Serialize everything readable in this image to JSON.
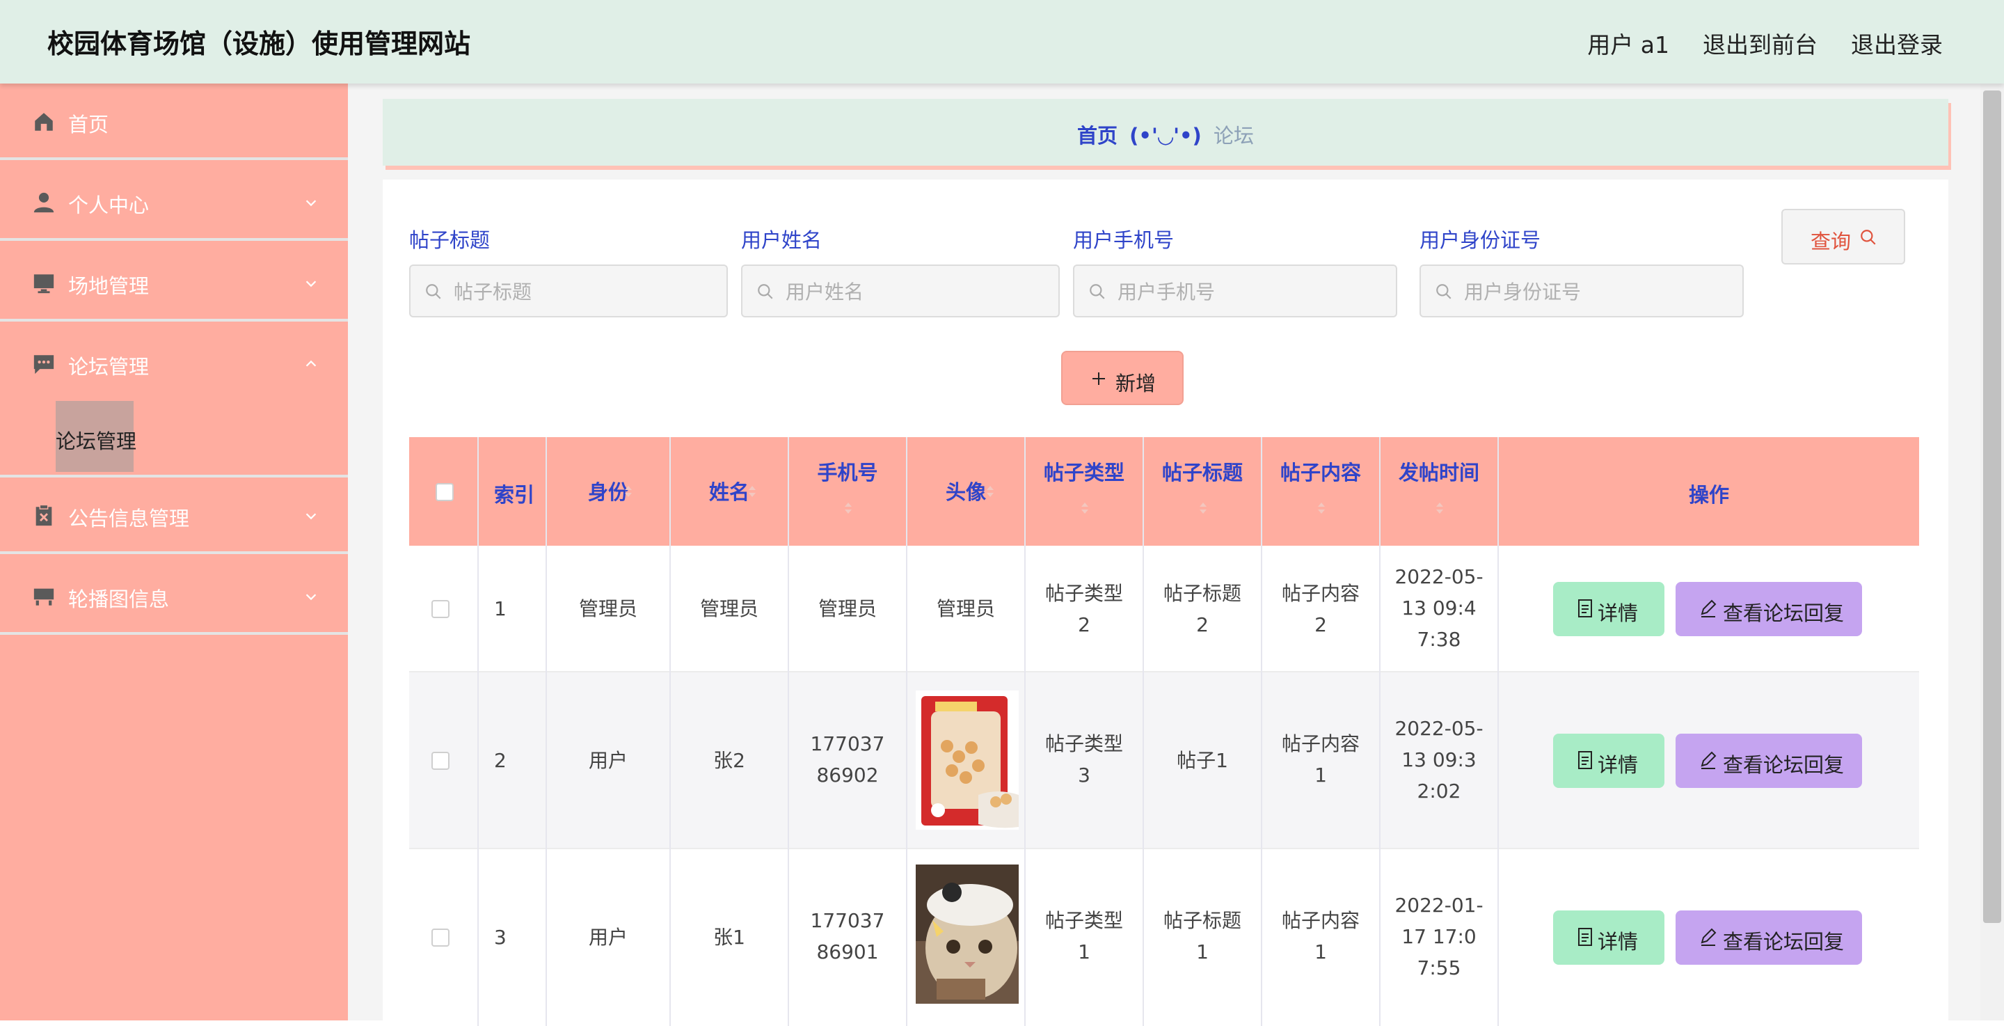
{
  "header": {
    "title": "校园体育场馆（设施）使用管理网站",
    "user": "用户 a1",
    "to_front": "退出到前台",
    "logout": "退出登录"
  },
  "sidebar": {
    "items": [
      {
        "label": "首页",
        "icon": "home-icon"
      },
      {
        "label": "个人中心",
        "icon": "user-icon"
      },
      {
        "label": "场地管理",
        "icon": "monitor-icon"
      },
      {
        "label": "论坛管理",
        "icon": "chat-icon",
        "expanded": true
      },
      {
        "label": "公告信息管理",
        "icon": "document-x-icon"
      },
      {
        "label": "轮播图信息",
        "icon": "carousel-icon"
      }
    ],
    "sub_item": "论坛管理"
  },
  "breadcrumb": {
    "home": "首页",
    "separator": "(•'◡'•)",
    "current": "论坛"
  },
  "search": {
    "fields": [
      {
        "label": "帖子标题",
        "placeholder": "帖子标题"
      },
      {
        "label": "用户姓名",
        "placeholder": "用户姓名"
      },
      {
        "label": "用户手机号",
        "placeholder": "用户手机号"
      },
      {
        "label": "用户身份证号",
        "placeholder": "用户身份证号"
      }
    ],
    "query_label": "查询",
    "add_label": "新增"
  },
  "table": {
    "headers": [
      "索引",
      "身份",
      "姓名",
      "手机号",
      "头像",
      "帖子类型",
      "帖子标题",
      "帖子内容",
      "发帖时间",
      "操作"
    ],
    "detail_label": "详情",
    "reply_label": "查看论坛回复",
    "rows": [
      {
        "index": "1",
        "role": "管理员",
        "name": "管理员",
        "phone": "管理员",
        "avatar": "管理员",
        "type": "帖子类型2",
        "title": "帖子标题2",
        "content": "帖子内容2",
        "time": "2022-05-13 09:47:38"
      },
      {
        "index": "2",
        "role": "用户",
        "name": "张2",
        "phone": "17703786902",
        "avatar": "",
        "type": "帖子类型3",
        "title": "帖子1",
        "content": "帖子内容1",
        "time": "2022-05-13 09:32:02"
      },
      {
        "index": "3",
        "role": "用户",
        "name": "张1",
        "phone": "17703786901",
        "avatar": "",
        "type": "帖子类型1",
        "title": "帖子标题1",
        "content": "帖子内容1",
        "time": "2022-01-17 17:07:55"
      }
    ]
  },
  "colors": {
    "header_bg": "#e0efe7",
    "sidebar_bg": "#ffada0",
    "accent_blue": "#2f44c9",
    "detail_btn": "#a8ecc6",
    "reply_btn": "#c5a4f0"
  }
}
